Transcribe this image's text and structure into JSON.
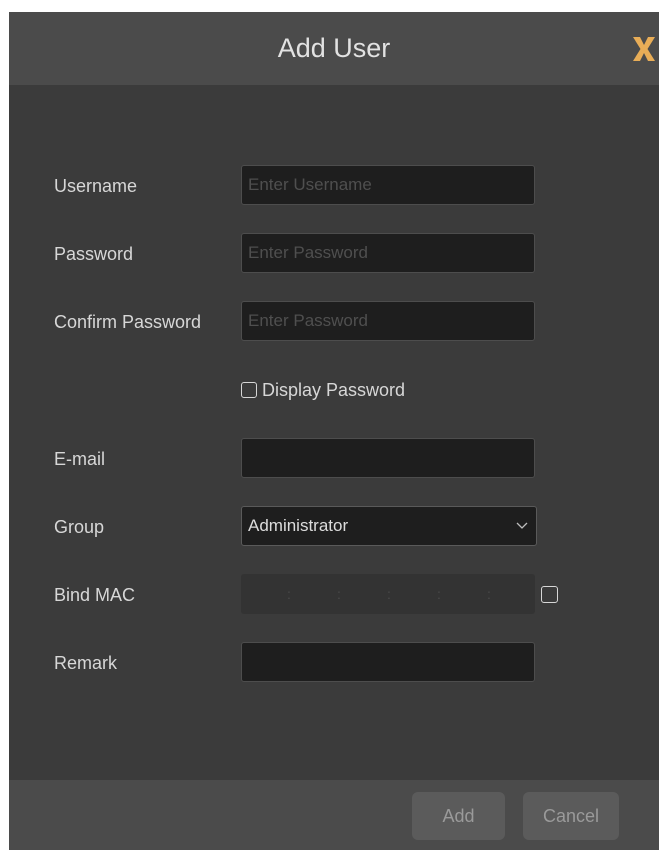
{
  "dialog": {
    "title": "Add User",
    "close_icon": "close-x-icon",
    "accent_color": "#e8ad57"
  },
  "form": {
    "username": {
      "label": "Username",
      "placeholder": "Enter Username",
      "value": ""
    },
    "password": {
      "label": "Password",
      "placeholder": "Enter Password",
      "value": ""
    },
    "confirm_password": {
      "label": "Confirm Password",
      "placeholder": "Enter Password",
      "value": ""
    },
    "display_password": {
      "label": "Display Password",
      "checked": false
    },
    "email": {
      "label": "E-mail",
      "value": ""
    },
    "group": {
      "label": "Group",
      "selected": "Administrator"
    },
    "bind_mac": {
      "label": "Bind MAC",
      "separators": [
        ":",
        ":",
        ":",
        ":",
        ":"
      ],
      "checked": false
    },
    "remark": {
      "label": "Remark",
      "value": ""
    }
  },
  "footer": {
    "add_label": "Add",
    "cancel_label": "Cancel"
  }
}
